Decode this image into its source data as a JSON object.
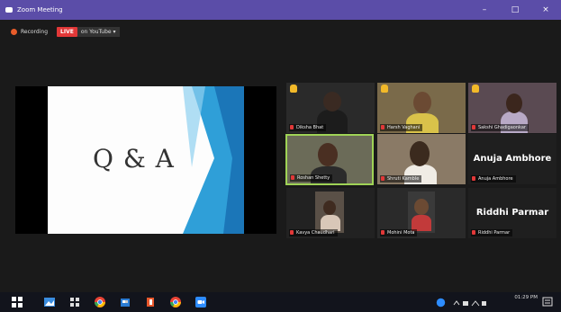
{
  "window": {
    "title": "Zoom Meeting",
    "minimize": "–",
    "maximize": "□",
    "close": "×"
  },
  "recording": {
    "label": "Recording",
    "live_badge": "LIVE",
    "youtube_label": "on YouTube ▾"
  },
  "shared_screen": {
    "slide_text": "Q & A"
  },
  "participants": [
    {
      "name": "Diksha Bhat",
      "hand_raised": true,
      "video": true
    },
    {
      "name": "Harsh Vaghani",
      "hand_raised": true,
      "video": true
    },
    {
      "name": "Sakshi Ghadigaonkar",
      "hand_raised": true,
      "video": true
    },
    {
      "name": "Roshan Shetty",
      "hand_raised": false,
      "video": true,
      "active_speaker": true
    },
    {
      "name": "Shruti Kamble",
      "hand_raised": false,
      "video": true
    },
    {
      "name": "Anuja Ambhore",
      "hand_raised": false,
      "video": false,
      "display_name": "Anuja Ambhore"
    },
    {
      "name": "Kavya Chaudhari",
      "hand_raised": false,
      "video": true
    },
    {
      "name": "Mohini Mota",
      "hand_raised": false,
      "video": true
    },
    {
      "name": "Riddhi Parmar",
      "hand_raised": false,
      "video": false,
      "display_name": "Riddhi Parmar"
    }
  ],
  "taskbar": {
    "icons": [
      "windows-start-icon",
      "photos-icon",
      "task-view-icon",
      "chrome-icon",
      "store-icon",
      "office-icon",
      "chrome-alt-icon",
      "zoom-icon"
    ],
    "tray_time": "01:29 PM"
  },
  "colors": {
    "titlebar": "#5b4da8",
    "live": "#e23838",
    "hand": "#f2b929",
    "active_border": "#9fd356"
  }
}
